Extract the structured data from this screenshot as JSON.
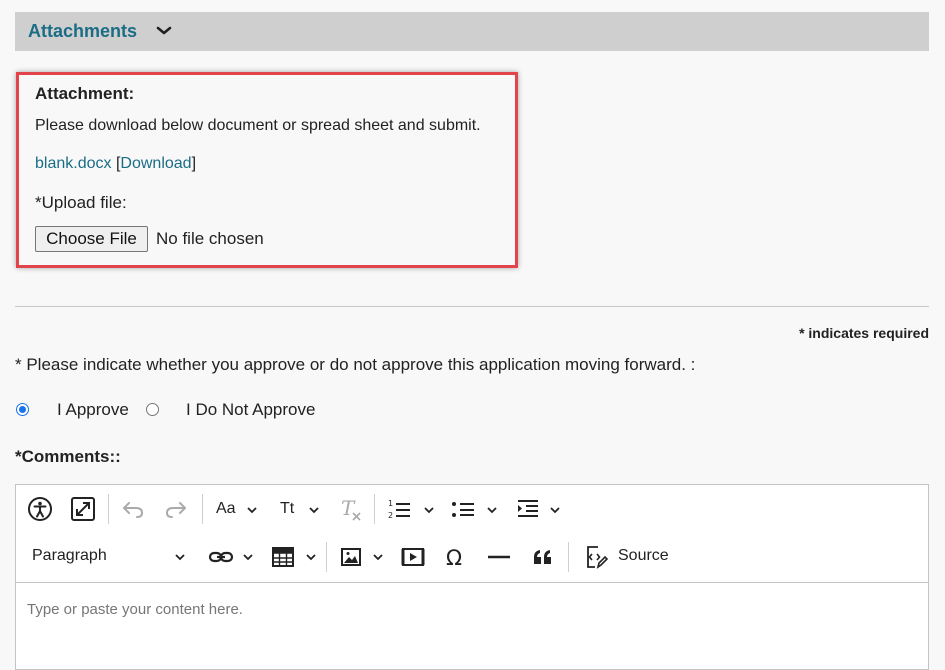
{
  "section": {
    "title": "Attachments"
  },
  "attachment": {
    "label": "Attachment:",
    "description": "Please download below document or spread sheet and submit.",
    "file_name": "blank.docx",
    "bracket_open": "[",
    "download_label": "Download",
    "bracket_close": "]",
    "upload_label": "*Upload file:",
    "choose_button": "Choose File",
    "no_file_text": "No file chosen"
  },
  "form": {
    "required_note": "* indicates required",
    "question": "* Please indicate whether you approve or do not approve this application moving forward. :",
    "options": [
      {
        "label": "I Approve",
        "checked": true
      },
      {
        "label": "I Do Not Approve",
        "checked": false
      }
    ],
    "comments_label": "*Comments::"
  },
  "editor": {
    "paragraph_select": "Paragraph",
    "font_size_label": "Aa",
    "text_transform_label": "Tt",
    "source_label": "Source",
    "placeholder": "Type or paste your content here."
  },
  "colors": {
    "link": "#1b6d86",
    "highlight_border": "#e2444b",
    "radio_accent": "#1a73e8"
  }
}
